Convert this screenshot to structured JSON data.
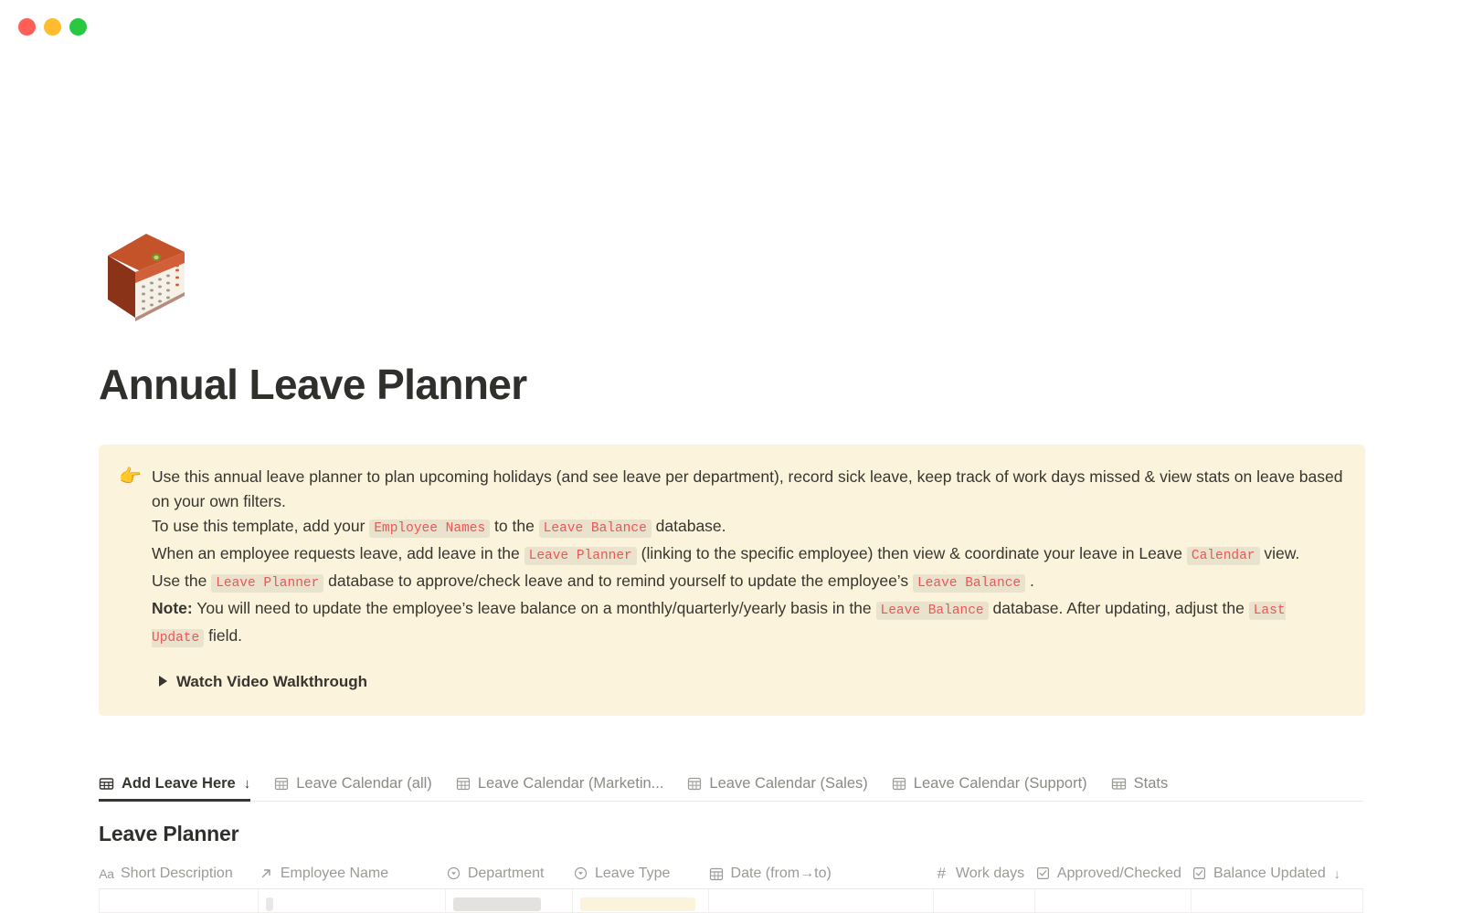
{
  "window": {
    "controls": [
      {
        "name": "close",
        "color": "#ff5f57"
      },
      {
        "name": "minimize",
        "color": "#febc2e"
      },
      {
        "name": "zoom",
        "color": "#28c840"
      }
    ]
  },
  "page": {
    "icon": "calendar-3d-icon",
    "title": "Annual Leave Planner"
  },
  "callout": {
    "emoji": "👉",
    "background": "#fbf3db",
    "code_color": "#eb5757",
    "lines": [
      {
        "segments": [
          {
            "type": "text",
            "text": "Use this annual leave planner to plan upcoming holidays (and see leave per department), record sick leave, keep track of work days missed & view stats on leave based on your own filters."
          }
        ]
      },
      {
        "segments": [
          {
            "type": "text",
            "text": "To use this template, add your "
          },
          {
            "type": "code",
            "text": "Employee Names"
          },
          {
            "type": "text",
            "text": " to the "
          },
          {
            "type": "code",
            "text": "Leave Balance"
          },
          {
            "type": "text",
            "text": " database."
          }
        ]
      },
      {
        "segments": [
          {
            "type": "text",
            "text": "When an employee requests leave, add leave in the "
          },
          {
            "type": "code",
            "text": "Leave Planner"
          },
          {
            "type": "text",
            "text": " (linking to the specific employee) then view & coordinate your leave in Leave "
          },
          {
            "type": "code",
            "text": "Calendar"
          },
          {
            "type": "text",
            "text": " view."
          }
        ]
      },
      {
        "segments": [
          {
            "type": "text",
            "text": "Use the "
          },
          {
            "type": "code",
            "text": "Leave Planner"
          },
          {
            "type": "text",
            "text": " database to approve/check leave and to remind yourself to update the employee’s "
          },
          {
            "type": "code",
            "text": "Leave Balance"
          },
          {
            "type": "text",
            "text": " ."
          }
        ]
      },
      {
        "segments": [
          {
            "type": "bold",
            "text": "Note:"
          },
          {
            "type": "text",
            "text": " You will need to update the employee’s leave balance on a monthly/quarterly/yearly basis in the "
          },
          {
            "type": "code",
            "text": "Leave Balance"
          },
          {
            "type": "text",
            "text": " database. After updating, adjust the "
          },
          {
            "type": "code",
            "text": "Last Update"
          },
          {
            "type": "text",
            "text": " field."
          }
        ]
      }
    ],
    "toggle": {
      "label": "Watch Video Walkthrough",
      "icon": "triangle-right-icon"
    }
  },
  "tabs": [
    {
      "label": "Add Leave Here",
      "icon": "table-icon",
      "suffix": "↓",
      "active": true
    },
    {
      "label": "Leave Calendar (all)",
      "icon": "calendar-icon",
      "suffix": "",
      "active": false
    },
    {
      "label": "Leave Calendar (Marketin...",
      "icon": "calendar-icon",
      "suffix": "",
      "active": false
    },
    {
      "label": "Leave Calendar (Sales)",
      "icon": "calendar-icon",
      "suffix": "",
      "active": false
    },
    {
      "label": "Leave Calendar (Support)",
      "icon": "calendar-icon",
      "suffix": "",
      "active": false
    },
    {
      "label": "Stats",
      "icon": "table-icon",
      "suffix": "",
      "active": false
    }
  ],
  "database": {
    "title": "Leave Planner",
    "columns": [
      {
        "label": "Short Description",
        "icon": "title-text-icon",
        "suffix": ""
      },
      {
        "label": "Employee Name",
        "icon": "relation-arrow-icon",
        "suffix": ""
      },
      {
        "label": "Department",
        "icon": "select-circle-icon",
        "suffix": ""
      },
      {
        "label": "Leave Type",
        "icon": "select-circle-icon",
        "suffix": ""
      },
      {
        "label": "Date (from→to)",
        "icon": "calendar-icon",
        "suffix": ""
      },
      {
        "label": "Work days",
        "icon": "number-hash-icon",
        "suffix": ""
      },
      {
        "label": "Approved/Checked",
        "icon": "checkbox-icon",
        "suffix": ""
      },
      {
        "label": "Balance Updated",
        "icon": "checkbox-icon",
        "suffix": "↓"
      }
    ]
  }
}
